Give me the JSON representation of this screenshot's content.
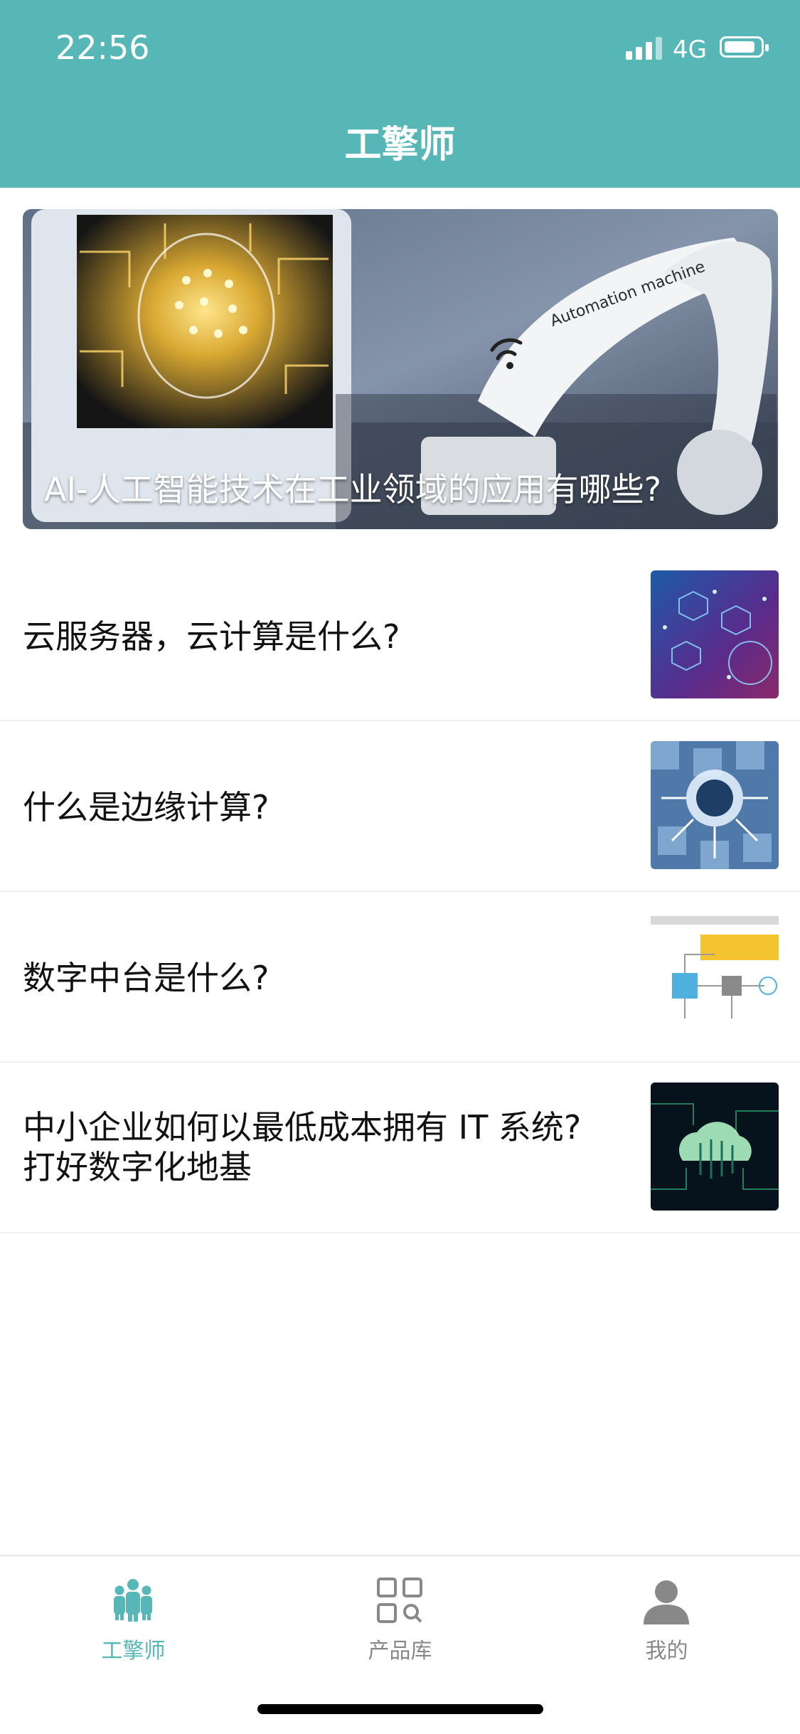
{
  "status_bar": {
    "time": "22:56",
    "network": "4G"
  },
  "header": {
    "title": "工擎师"
  },
  "hero": {
    "title": "AI-人工智能技术在工业领域的应用有哪些?",
    "image_text": "Automation machine"
  },
  "articles": [
    {
      "title": "云服务器，云计算是什么?"
    },
    {
      "title": "什么是边缘计算?"
    },
    {
      "title": "数字中台是什么?"
    },
    {
      "title_line1": "中小企业如何以最低成本拥有 IT 系统?",
      "title_line2": "打好数字化地基"
    }
  ],
  "tabs": [
    {
      "label": "工擎师",
      "active": true,
      "icon": "engineers-icon"
    },
    {
      "label": "产品库",
      "active": false,
      "icon": "product-library-icon"
    },
    {
      "label": "我的",
      "active": false,
      "icon": "profile-icon"
    }
  ],
  "colors": {
    "primary": "#57b6b6",
    "inactive": "#888888"
  }
}
